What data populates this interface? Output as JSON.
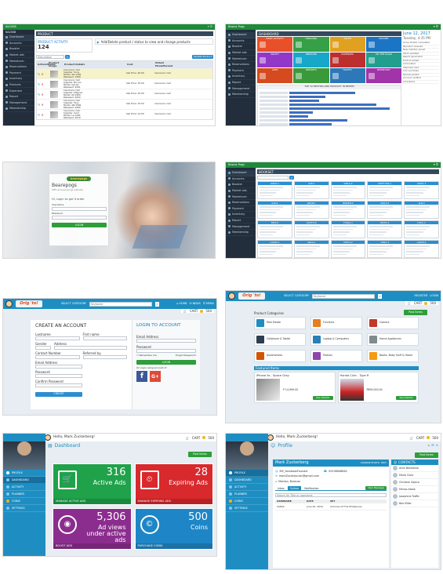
{
  "s1": {
    "brand": "Ka2008",
    "user": "KA2008",
    "menu": [
      "Dashboard",
      "Accounts",
      "Booster",
      "Market ads",
      "Marketcoin",
      "Reservations",
      "Payment",
      "Inventory",
      "Products",
      "Expenses",
      "Report",
      "Management",
      "Membership"
    ],
    "panel_title": "PRODUCT",
    "subhead": "PRODUCT ACTIVITY",
    "count": "124",
    "notice": "Add/Delete product / status to view and change products",
    "search_placeholder": "Description",
    "add_btn": "Update Product",
    "cols": [
      "Action/Status",
      "Product Image",
      "Product Details",
      "Cost",
      "Oldest Hired/Earned"
    ],
    "rows": [
      [
        "Insurance: Carl",
        "Supplier: Sony",
        "Model: SD-1002",
        "Released: 1999",
        "Sell Price: 40.00"
      ],
      [
        "Insurance: Carl",
        "Supplier: Bio-Inc",
        "Model: CJ4-A2",
        "Released: 2001",
        "Sell Price: 35.00"
      ],
      [
        "Insurance: Carl",
        "Supplier: Magnet",
        "Model: KP-2200",
        "Released: 2004",
        "Sell Price: 25.00"
      ],
      [
        "Insurance: Carl",
        "Supplier: Toyo",
        "Model: AB-3399",
        "Released: 2005",
        "Sell Price: 19.50"
      ],
      [
        "Insurance: Carl",
        "Supplier: Gold",
        "Model: LL-1200",
        "Released: 2010",
        "Sell Price: 12.00"
      ]
    ]
  },
  "s2": {
    "brand": "Bewra Pogs",
    "panel": "DASHBOARD",
    "date": "June 12, 2017",
    "time": "Tuesday, 4:35 PM",
    "menu": [
      "Dashboard",
      "Accounts",
      "Booster",
      "Market ads",
      "Marketcoin",
      "Reservations",
      "Payment",
      "Inventory",
      "Report",
      "Management",
      "Membership"
    ],
    "tiles": [
      {
        "t": "DAILY ACTIVITY",
        "c": "#e8502a"
      },
      {
        "t": "ONGOING",
        "c": "#35a046"
      },
      {
        "t": "SALES",
        "c": "#e0a020"
      },
      {
        "t": "INCOME",
        "c": "#1c74c4"
      },
      {
        "t": "PROFIT",
        "c": "#9238c8"
      },
      {
        "t": "INBOUND",
        "c": "#17a7c8"
      },
      {
        "t": "EXPENSES",
        "c": "#bd2f2f"
      },
      {
        "t": "ON THE ROAD",
        "c": "#219e8e"
      },
      {
        "t": "APPS",
        "c": "#d54a1e"
      },
      {
        "t": "REPORTS",
        "c": "#3a9a3a"
      },
      {
        "t": "TRAFFIC",
        "c": "#2d78b8"
      },
      {
        "t": "INVENTORY",
        "c": "#a034a8"
      }
    ],
    "chart_title": "TOP 10 BESTSELLING PRODUCT IN BEOPPI",
    "feed": [
      "Order #1021 completed",
      "Payment received",
      "New member joined",
      "Stock updated",
      "Report generated",
      "Product added",
      "Ad boosted",
      "Shipment sent",
      "Coin purchase",
      "Review posted",
      "Account verified",
      "Ad expired"
    ]
  },
  "s3": {
    "logo": "bearepogs",
    "title": "Bearepogs",
    "subtitle": "Official bearepogs website",
    "greeting": "Hi, Login to get it order",
    "user_label": "Username",
    "pass_label": "Password",
    "login_btn": "LOGIN"
  },
  "s4": {
    "brand": "Bewra Pogs",
    "panel": "BOOKSET",
    "menu": [
      "Dashboard",
      "Accounts",
      "Booster",
      "Market ads",
      "Marketcoin",
      "Reservations",
      "Payment",
      "Inventory",
      "Report",
      "Management",
      "Membership"
    ],
    "cards": [
      "GIRLS-1",
      "ALB-1",
      "GIRLS-2",
      "MATT-HAS-1",
      "GIRLS-3",
      "ALB-2",
      "JAPAN-1",
      "BIRKEN-2",
      "GIRLS-4",
      "ALB-3",
      "BRIT-9",
      "SOUTH-8",
      "FLORA-1",
      "MOTO-1",
      "LYRIC-2",
      "LATAM-1",
      "ARCA-1",
      "MOTO-2",
      "LYRIC-3",
      "LATAM-2"
    ]
  },
  "s5": {
    "logo": "Orig 'to!",
    "cat_label": "SELECT CATEGORY",
    "search": "Keyboard",
    "nav": [
      "HOME",
      "NEWS",
      "MENU"
    ],
    "cart": "CART",
    "coins": "500",
    "create_title": "CREATE AN ACCOUNT",
    "f_last": "Lastname",
    "f_first": "First name",
    "f_gender": "Gender",
    "f_address": "Address",
    "f_contact": "Contact Number",
    "f_ref": "Referred by",
    "f_email": "Email Address",
    "f_pass": "Password",
    "f_confirm": "Confirm Password",
    "create_btn": "CREATE",
    "login_title": "LOGIN TO ACCOUNT",
    "l_email": "Email Address",
    "l_pass": "Password",
    "remember": "Remember me",
    "forgot": "Forgot Password?",
    "login_btn": "LOGIN",
    "or": "Or Login using account of"
  },
  "s6": {
    "logo": "Orig 'to!",
    "cat_label": "SELECT CATEGORY",
    "search": "Keyboard",
    "register": "REGISTER",
    "login": "LOGIN",
    "cart": "CART",
    "coins": "500",
    "post_btn": "Post Items",
    "cat_title": "Product Categories",
    "cats": [
      "Real Estate",
      "Furniture",
      "Camera",
      "Cellphone & Tablet",
      "Laptop & Computers",
      "Home Appliances",
      "Automotives",
      "Fashion",
      "Books, Baby Stuff & Home"
    ],
    "featured": "Featured Items",
    "items": [
      {
        "name": "iPhone 5s - Space Gray",
        "price": "P 14,999.00",
        "det": "See Details"
      },
      {
        "name": "Honda Civic - Type R",
        "price": "P890,000.00",
        "det": "See Details"
      }
    ]
  },
  "s7": {
    "greet": "Hello, Mark Zuckerberg!",
    "cart": "CART",
    "coins": "500",
    "title": "Dashboard",
    "post_btn": "Post Items",
    "menu": [
      "PROFILE",
      "DASHBOARD",
      "ACTIVITY",
      "PLANNER",
      "COINS",
      "SETTINGS"
    ],
    "tiles": [
      {
        "num": "316",
        "lbl": "Active Ads",
        "foot": "MANAGE ACTIVE ADS",
        "c": "#1fa24a"
      },
      {
        "num": "28",
        "lbl": "Expiring Ads",
        "foot": "MANAGE EXPIRING ADS",
        "c": "#d8292d"
      },
      {
        "num": "5,306",
        "lbl": "Ad views under active ads",
        "foot": "BOOST ADS",
        "c": "#8b2d8e"
      },
      {
        "num": "500",
        "lbl": "Coins",
        "foot": "PURCHASE COINS",
        "c": "#1e86c6"
      }
    ]
  },
  "s8": {
    "greet": "Hello, Mark Zuckerberg!",
    "cart": "CART",
    "coins": "500",
    "title": "Profile",
    "post_btn": "Post Items",
    "menu": [
      "PROFILE",
      "DASHBOARD",
      "ACTIVITY",
      "PLANNER",
      "COINS",
      "SETTINGS"
    ],
    "name": "Mark Zuckerberg",
    "change": "CHANGE PHOTO",
    "edit": "EDIT",
    "handle": "MZ_facebookFounder",
    "phone": "09238648862",
    "email": "markZuckerjunior@gmail.com",
    "loc": "Marilao, Bulacan",
    "tabs": [
      "Inbox",
      "Outbox",
      "Notification"
    ],
    "new_msg": "New Message",
    "search_ph": "Search for Title or username",
    "cols": [
      "USERNAME",
      "DATE",
      "SET"
    ],
    "msg": [
      "SAPAK",
      "June 20, 2016",
      "Airhorse Of The Philippines"
    ],
    "contacts_title": "CONTACTS",
    "contacts": [
      "Alvin Benedicto",
      "Maria Clara",
      "Christian Sapico",
      "Mirnas Abala",
      "Josephine Traffic",
      "Bea Miller"
    ]
  }
}
